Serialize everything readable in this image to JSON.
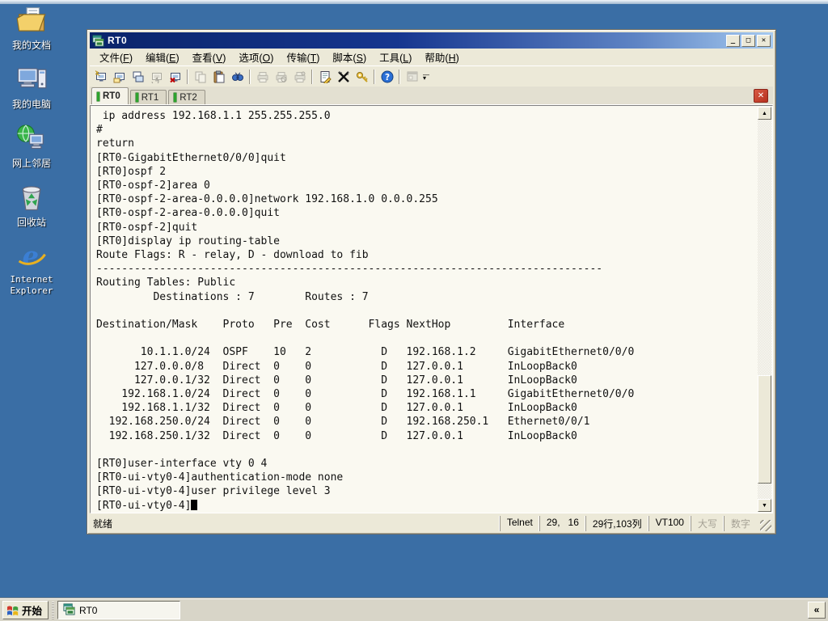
{
  "colors": {
    "desktop_bg": "#3A6EA5",
    "titlebar_from": "#0A246A",
    "titlebar_to": "#A6CAF0",
    "chrome": "#ECE9D8",
    "terminal_bg": "#FAF9F1",
    "tab_indicator_green": "#2DA32D",
    "tab_close_red": "#C8402F"
  },
  "desktop": {
    "icons": [
      {
        "id": "my-documents",
        "label": "我的文档"
      },
      {
        "id": "my-computer",
        "label": "我的电脑"
      },
      {
        "id": "network-places",
        "label": "网上邻居"
      },
      {
        "id": "recycle-bin",
        "label": "回收站"
      },
      {
        "id": "internet-explorer",
        "label": "Internet\nExplorer"
      }
    ]
  },
  "window": {
    "title": "RT0",
    "controls": {
      "minimize": "_",
      "maximize": "□",
      "close": "✕"
    },
    "menus": [
      {
        "pre": "文件",
        "key": "F"
      },
      {
        "pre": "编辑",
        "key": "E"
      },
      {
        "pre": "查看",
        "key": "V"
      },
      {
        "pre": "选项",
        "key": "O"
      },
      {
        "pre": "传输",
        "key": "T"
      },
      {
        "pre": "脚本",
        "key": "S"
      },
      {
        "pre": "工具",
        "key": "L"
      },
      {
        "pre": "帮助",
        "key": "H"
      }
    ],
    "toolbar": [
      {
        "name": "quick-connect-icon",
        "enabled": true
      },
      {
        "name": "connect-icon",
        "enabled": true
      },
      {
        "name": "connect-in-tab-icon",
        "enabled": true
      },
      {
        "name": "reconnect-icon",
        "enabled": false
      },
      {
        "name": "disconnect-icon",
        "enabled": true
      },
      {
        "sep": true
      },
      {
        "name": "copy-icon",
        "enabled": false
      },
      {
        "name": "paste-icon",
        "enabled": true
      },
      {
        "name": "find-icon",
        "enabled": true
      },
      {
        "sep": true
      },
      {
        "name": "print-icon",
        "enabled": false
      },
      {
        "name": "print-preview-icon",
        "enabled": false
      },
      {
        "name": "print-setup-icon",
        "enabled": false
      },
      {
        "sep": true
      },
      {
        "name": "properties-icon",
        "enabled": true
      },
      {
        "name": "session-options-icon",
        "enabled": true
      },
      {
        "name": "key-agent-icon",
        "enabled": true
      },
      {
        "sep": true
      },
      {
        "name": "help-icon",
        "enabled": true
      },
      {
        "sep": true
      },
      {
        "name": "app-window-icon",
        "enabled": false
      }
    ],
    "tabs": [
      {
        "label": "RT0",
        "active": true
      },
      {
        "label": "RT1",
        "active": false
      },
      {
        "label": "RT2",
        "active": false
      }
    ],
    "tab_close_glyph": "✕",
    "terminal": {
      "lines": [
        " ip address 192.168.1.1 255.255.255.0",
        "#",
        "return",
        "[RT0-GigabitEthernet0/0/0]quit",
        "[RT0]ospf 2",
        "[RT0-ospf-2]area 0",
        "[RT0-ospf-2-area-0.0.0.0]network 192.168.1.0 0.0.0.255",
        "[RT0-ospf-2-area-0.0.0.0]quit",
        "[RT0-ospf-2]quit",
        "[RT0]display ip routing-table",
        "Route Flags: R - relay, D - download to fib",
        "--------------------------------------------------------------------------------",
        "Routing Tables: Public",
        "         Destinations : 7        Routes : 7",
        "",
        "Destination/Mask    Proto   Pre  Cost      Flags NextHop         Interface",
        "",
        "       10.1.1.0/24  OSPF    10   2           D   192.168.1.2     GigabitEthernet0/0/0",
        "      127.0.0.0/8   Direct  0    0           D   127.0.0.1       InLoopBack0",
        "      127.0.0.1/32  Direct  0    0           D   127.0.0.1       InLoopBack0",
        "    192.168.1.0/24  Direct  0    0           D   192.168.1.1     GigabitEthernet0/0/0",
        "    192.168.1.1/32  Direct  0    0           D   127.0.0.1       InLoopBack0",
        "  192.168.250.0/24  Direct  0    0           D   192.168.250.1   Ethernet0/0/1",
        "  192.168.250.1/32  Direct  0    0           D   127.0.0.1       InLoopBack0",
        "",
        "[RT0]user-interface vty 0 4",
        "[RT0-ui-vty0-4]authentication-mode none",
        "[RT0-ui-vty0-4]user privilege level 3"
      ],
      "prompt": "[RT0-ui-vty0-4]"
    },
    "statusbar": {
      "left": "就绪",
      "panels": [
        {
          "text": "Telnet",
          "disabled": false
        },
        {
          "text": "29,   16",
          "disabled": false
        },
        {
          "text": "29行,103列",
          "disabled": false
        },
        {
          "text": "VT100",
          "disabled": false
        },
        {
          "text": "大写",
          "disabled": true
        },
        {
          "text": "数字",
          "disabled": true
        }
      ]
    }
  },
  "taskbar": {
    "start_label": "开始",
    "tasks": [
      {
        "label": "RT0"
      }
    ],
    "tray_chevron": "«"
  }
}
